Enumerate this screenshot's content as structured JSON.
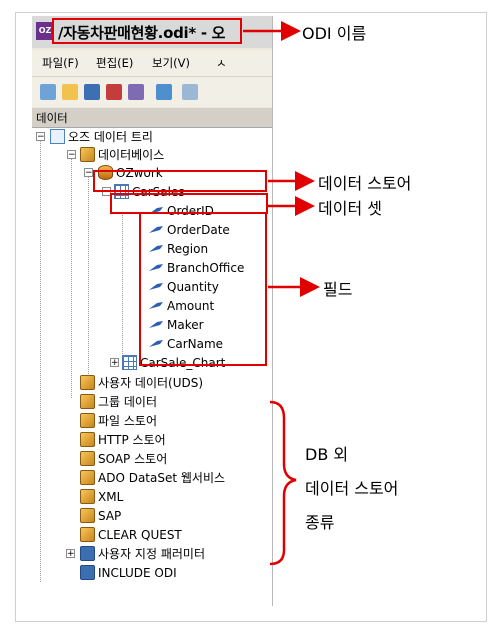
{
  "window": {
    "title": "/자동차판매현황.odi* - 오",
    "app_icon_text": "OZ"
  },
  "menu": [
    "파일(F)",
    "편집(E)",
    "보기(V)",
    "ㅅ"
  ],
  "panel_header": "데이터",
  "tree": {
    "root": "오즈 데이터 트리",
    "database": "데이터베이스",
    "datastore": "OZwork",
    "dataset": "CarSales",
    "fields": [
      "OrderID",
      "OrderDate",
      "Region",
      "BranchOffice",
      "Quantity",
      "Amount",
      "Maker",
      "CarName"
    ],
    "dataset2": "CarSale_Chart",
    "other_stores": [
      "사용자 데이터(UDS)",
      "그룹 데이터",
      "파일 스토어",
      "HTTP 스토어",
      "SOAP 스토어",
      "ADO DataSet 웹서비스",
      "XML",
      "SAP",
      "CLEAR QUEST"
    ],
    "params": "사용자 지정 패러미터",
    "include": "INCLUDE ODI"
  },
  "callouts": {
    "odi_name": "ODI 이름",
    "data_store": "데이터 스토어",
    "data_set": "데이터 셋",
    "field": "필드",
    "db_other_line1": "DB 외",
    "db_other_line2": "데이터 스토어",
    "db_other_line3": "종류"
  },
  "colors": {
    "accent_red": "#e00000"
  }
}
